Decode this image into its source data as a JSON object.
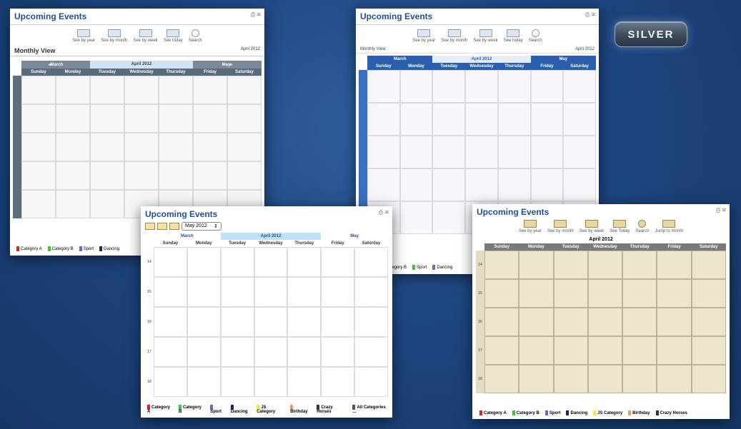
{
  "badge": "SILVER",
  "s1": {
    "title": "Upcoming Events",
    "view_title": "Monthly View",
    "date_label": "April 2012",
    "prev": "◂March",
    "current": "April 2012",
    "next": "May▸",
    "tools": [
      "See by year",
      "See by month",
      "See by week",
      "See today",
      "Search"
    ],
    "days": [
      "Sunday",
      "Monday",
      "Tuesday",
      "Wednesday",
      "Thursday",
      "Friday",
      "Saturday"
    ],
    "legend": [
      "Category A",
      "Category B",
      "Sport",
      "Dancing"
    ],
    "colors": {
      "header": "#5b6b7c",
      "nav": "#7a8998",
      "current": "#cfe3f5",
      "weekcol": "#5f6e7d"
    }
  },
  "s2": {
    "title": "Upcoming Events",
    "view_title": "Monthly View",
    "date_label": "April 2012",
    "prev": "March",
    "current": "April 2012",
    "next": "May",
    "tools": [
      "See by year",
      "See by month",
      "See by week",
      "See today",
      "Search"
    ],
    "days": [
      "Sunday",
      "Monday",
      "Tuesday",
      "Wednesday",
      "Thursday",
      "Friday",
      "Saturday"
    ],
    "legend": [
      "Category B",
      "Sport",
      "Dancing"
    ],
    "colors": {
      "header": "#2a5fb0",
      "weekcol": "#3a6fc3"
    }
  },
  "s3": {
    "title": "Upcoming Events",
    "month_select": "May 2012",
    "prev": "March",
    "current": "April 2012",
    "next": "May",
    "days": [
      "Sunday",
      "Monday",
      "Tuesday",
      "Wednesday",
      "Thursday",
      "Friday",
      "Saturday"
    ],
    "weeks": [
      "14",
      "15",
      "16",
      "17",
      "18"
    ],
    "legend": [
      "Category A",
      "Category B",
      "Sport",
      "Dancing",
      "JS Category",
      "Birthday",
      "Crazy Horses",
      "All Categories ..."
    ]
  },
  "s4": {
    "title": "Upcoming Events",
    "month": "April 2012",
    "tools": [
      "See by year",
      "See by month",
      "See by week",
      "See Today",
      "Search",
      "Jump to month"
    ],
    "days": [
      "Sunday",
      "Monday",
      "Tuesday",
      "Wednesday",
      "Thursday",
      "Friday",
      "Saturday"
    ],
    "weeks": [
      "14",
      "15",
      "16",
      "17",
      "18"
    ],
    "legend": [
      "Category A",
      "Category B",
      "Sport",
      "Dancing",
      "JS Category",
      "Birthday",
      "Crazy Horses"
    ]
  }
}
